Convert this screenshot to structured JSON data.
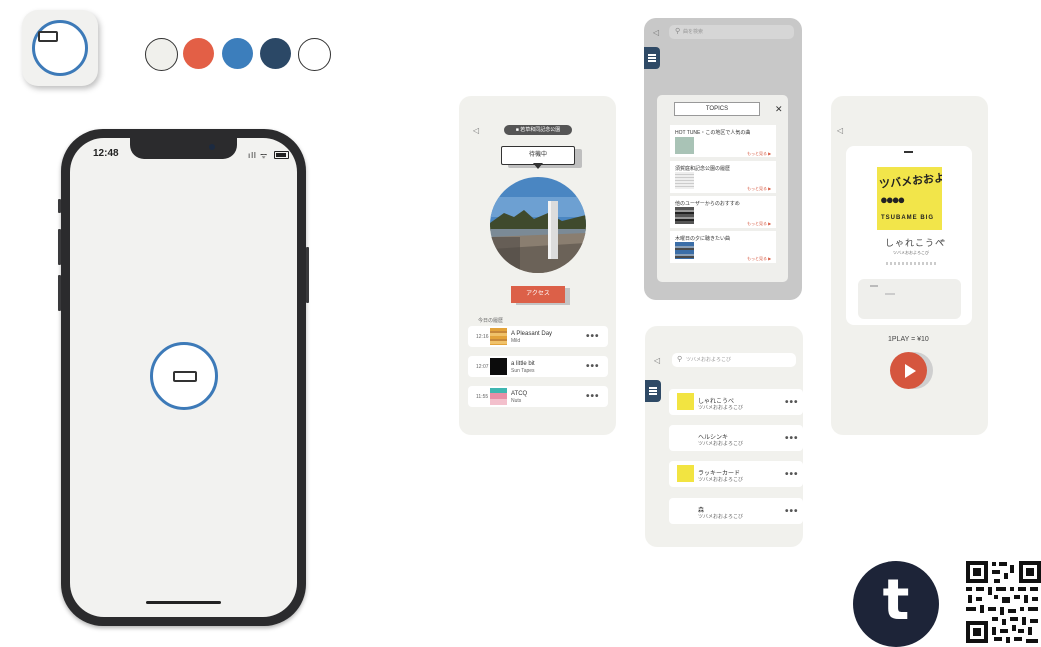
{
  "palette": [
    "#f0f0ec",
    "#e35f46",
    "#3c7ebc",
    "#2b4866",
    "#ffffff"
  ],
  "phone": {
    "time": "12:48",
    "status": "ıll ᯤ"
  },
  "card1": {
    "back": "◁",
    "badge": "■ 若草和同記念公園",
    "bubble": "待機中",
    "access_button": "アクセス",
    "history_label": "今日の履歴",
    "rows": [
      {
        "time": "12:16",
        "title": "A Pleasant Day",
        "artist": "Mild"
      },
      {
        "time": "12:07",
        "title": "a little bit",
        "artist": "Sun Tapes"
      },
      {
        "time": "11:55",
        "title": "ATCQ",
        "artist": "Nuts"
      }
    ]
  },
  "card2": {
    "back": "◁",
    "search_placeholder": "曲を検索",
    "topics_title": "TOPICS",
    "close": "✕",
    "topics": [
      {
        "title": "HOT TUNE・この地区で人気の曲"
      },
      {
        "title": "須賀庭和記念公園の履歴"
      },
      {
        "title": "他のユーザーからのおすすめ"
      },
      {
        "title": "木曜日の夕に聴きたい曲"
      }
    ],
    "more": "もっと見る ▶"
  },
  "card3": {
    "back": "◁",
    "search_placeholder": "ツバメおおよろこび",
    "songs": [
      {
        "title": "しゃれこうべ",
        "artist": "ツバメおおよろこび"
      },
      {
        "title": "ヘルシンキ",
        "artist": "ツバメおおよろこび"
      },
      {
        "title": "ラッキーカード",
        "artist": "ツバメおおよろこび"
      },
      {
        "title": "森",
        "artist": "ツバメおおよろこび"
      }
    ]
  },
  "card4": {
    "back": "◁",
    "album_text": "ツバメおおよろ",
    "album_band": "TSUBAME BIG",
    "song_title": "しゃれこうべ",
    "artist": "ツバメおおよろこび",
    "price": "1PLAY = ¥10"
  },
  "tumblr_letter": "t"
}
